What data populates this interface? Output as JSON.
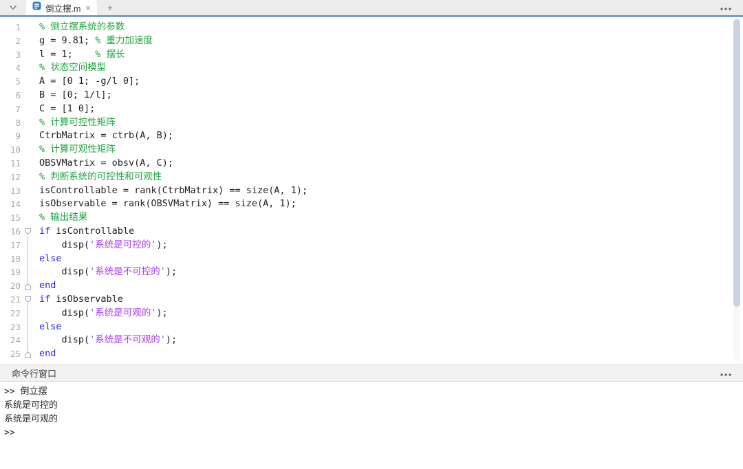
{
  "window": {
    "accent_color": "#7d9cc2",
    "tab_bar": {
      "dropdown_icon": "chevron-down-icon",
      "tab_title": "倒立摆.m",
      "file_icon": "mfile-document-icon",
      "close_glyph": "×",
      "new_tab_glyph": "+",
      "overflow_icon": "ellipsis-icon"
    }
  },
  "editor": {
    "colors": {
      "comment": "#1fa23e",
      "keyword": "#2424ee",
      "string": "#a93bf0",
      "code": "#1f1f1f",
      "line_number": "#ababab"
    },
    "scrollbar_color": "#c8d2e0",
    "lines": [
      {
        "n": 1,
        "tokens": [
          {
            "t": "% 倒立摆系统的参数",
            "c": "comment"
          }
        ]
      },
      {
        "n": 2,
        "tokens": [
          {
            "t": "g = 9.81; ",
            "c": "code"
          },
          {
            "t": "% 重力加速度",
            "c": "comment"
          }
        ]
      },
      {
        "n": 3,
        "tokens": [
          {
            "t": "l = 1;    ",
            "c": "code"
          },
          {
            "t": "% 摆长",
            "c": "comment"
          }
        ]
      },
      {
        "n": 4,
        "tokens": [
          {
            "t": "% 状态空间模型",
            "c": "comment"
          }
        ]
      },
      {
        "n": 5,
        "tokens": [
          {
            "t": "A = [0 1; -g/l 0];",
            "c": "code"
          }
        ]
      },
      {
        "n": 6,
        "tokens": [
          {
            "t": "B = [0; 1/l];",
            "c": "code"
          }
        ]
      },
      {
        "n": 7,
        "tokens": [
          {
            "t": "C = [1 0];",
            "c": "code"
          }
        ]
      },
      {
        "n": 8,
        "tokens": [
          {
            "t": "% 计算可控性矩阵",
            "c": "comment"
          }
        ]
      },
      {
        "n": 9,
        "tokens": [
          {
            "t": "CtrbMatrix = ctrb(A, B);",
            "c": "code"
          }
        ]
      },
      {
        "n": 10,
        "tokens": [
          {
            "t": "% 计算可观性矩阵",
            "c": "comment"
          }
        ]
      },
      {
        "n": 11,
        "tokens": [
          {
            "t": "OBSVMatrix = obsv(A, C);",
            "c": "code"
          }
        ]
      },
      {
        "n": 12,
        "tokens": [
          {
            "t": "% 判断系统的可控性和可观性",
            "c": "comment"
          }
        ]
      },
      {
        "n": 13,
        "tokens": [
          {
            "t": "isControllable = rank(CtrbMatrix) == size(A, 1);",
            "c": "code"
          }
        ]
      },
      {
        "n": 14,
        "tokens": [
          {
            "t": "isObservable = rank(OBSVMatrix) == size(A, 1);",
            "c": "code"
          }
        ]
      },
      {
        "n": 15,
        "tokens": [
          {
            "t": "% 输出结果",
            "c": "comment"
          }
        ]
      },
      {
        "n": 16,
        "fold": "start",
        "tokens": [
          {
            "t": "if",
            "c": "keyword"
          },
          {
            "t": " isControllable",
            "c": "code"
          }
        ]
      },
      {
        "n": 17,
        "fold": "mid",
        "tokens": [
          {
            "t": "    disp(",
            "c": "code"
          },
          {
            "t": "'系统是可控的'",
            "c": "string"
          },
          {
            "t": ");",
            "c": "code"
          }
        ]
      },
      {
        "n": 18,
        "fold": "mid",
        "tokens": [
          {
            "t": "else",
            "c": "keyword"
          }
        ]
      },
      {
        "n": 19,
        "fold": "mid",
        "tokens": [
          {
            "t": "    disp(",
            "c": "code"
          },
          {
            "t": "'系统是不可控的'",
            "c": "string"
          },
          {
            "t": ");",
            "c": "code"
          }
        ]
      },
      {
        "n": 20,
        "fold": "end",
        "tokens": [
          {
            "t": "end",
            "c": "keyword"
          }
        ]
      },
      {
        "n": 21,
        "fold": "start",
        "tokens": [
          {
            "t": "if",
            "c": "keyword"
          },
          {
            "t": " isObservable",
            "c": "code"
          }
        ]
      },
      {
        "n": 22,
        "fold": "mid",
        "tokens": [
          {
            "t": "    disp(",
            "c": "code"
          },
          {
            "t": "'系统是可观的'",
            "c": "string"
          },
          {
            "t": ");",
            "c": "code"
          }
        ]
      },
      {
        "n": 23,
        "fold": "mid",
        "tokens": [
          {
            "t": "else",
            "c": "keyword"
          }
        ]
      },
      {
        "n": 24,
        "fold": "mid",
        "tokens": [
          {
            "t": "    disp(",
            "c": "code"
          },
          {
            "t": "'系统是不可观的'",
            "c": "string"
          },
          {
            "t": ");",
            "c": "code"
          }
        ]
      },
      {
        "n": 25,
        "fold": "end",
        "tokens": [
          {
            "t": "end",
            "c": "keyword"
          }
        ]
      }
    ]
  },
  "command_window": {
    "title": "命令行窗口",
    "overflow_icon": "ellipsis-icon",
    "lines": [
      ">> 倒立摆",
      "系统是可控的",
      "系统是可观的",
      ">>"
    ]
  }
}
